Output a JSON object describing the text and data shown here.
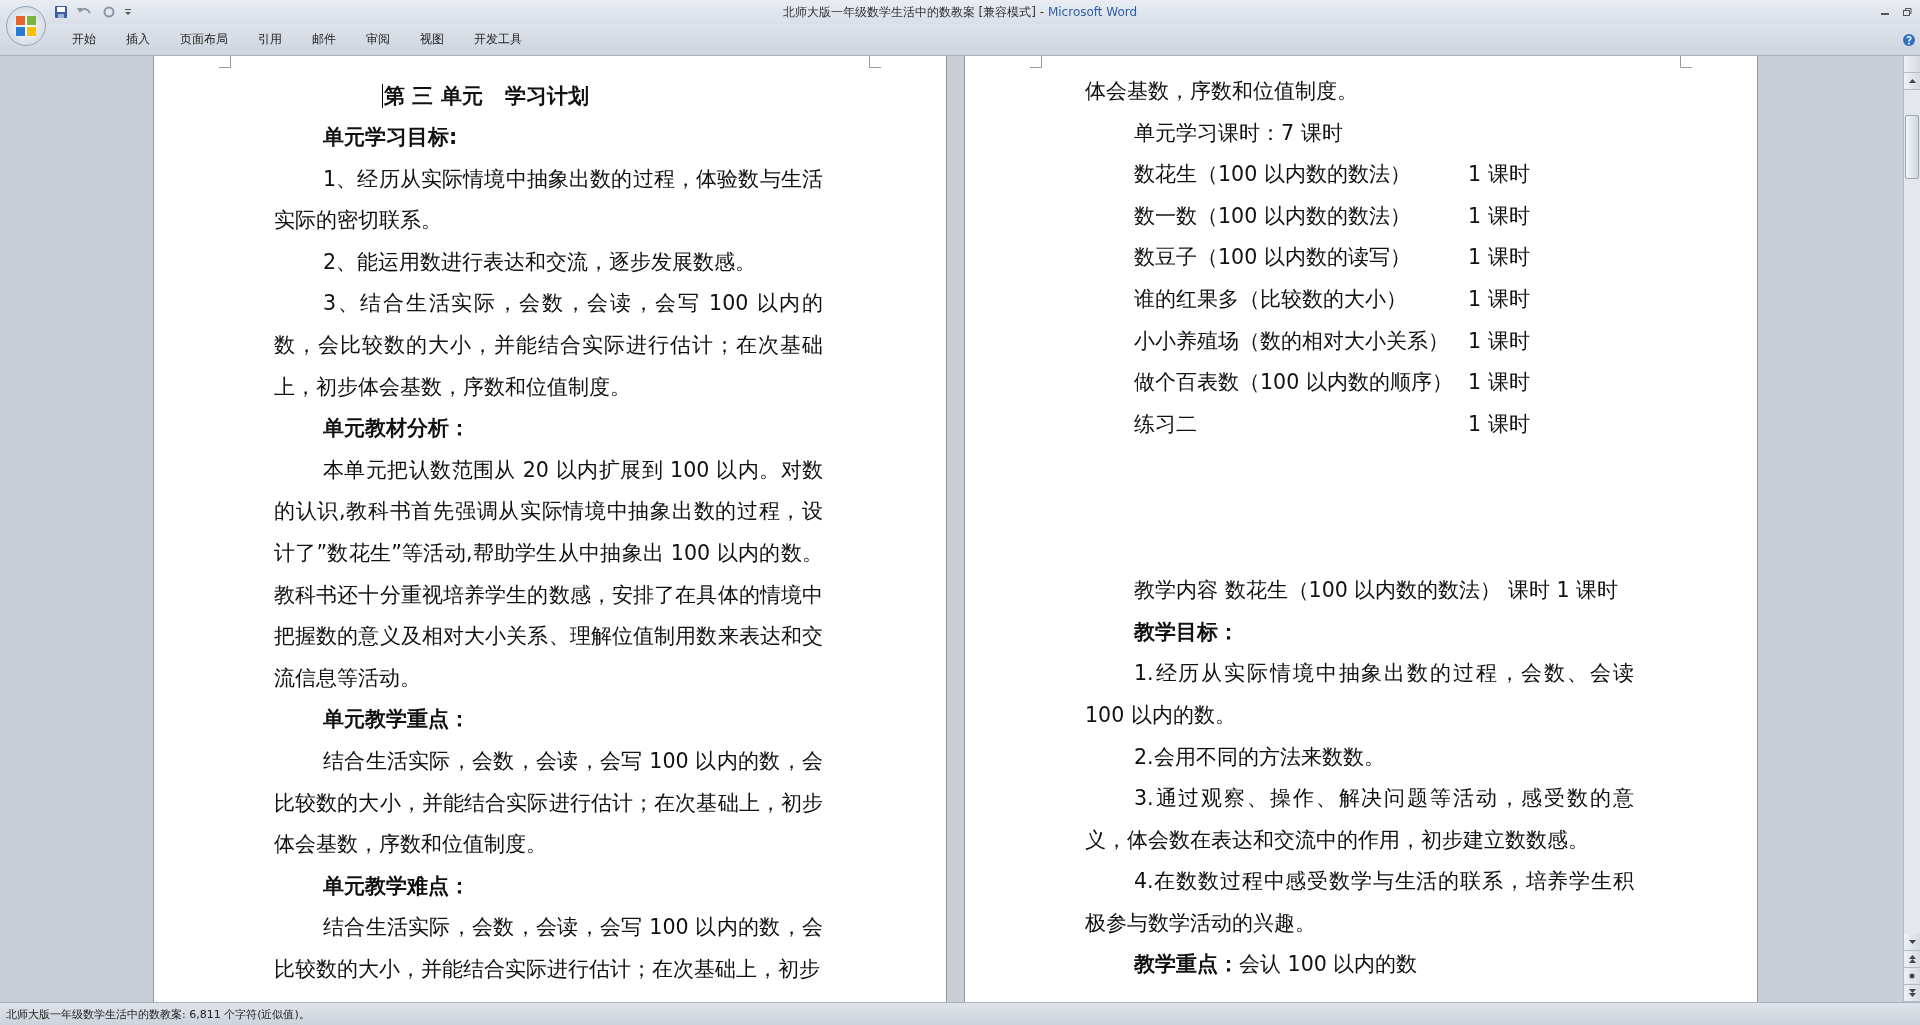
{
  "window": {
    "document": "北师大版一年级数学生活中的数教案 [兼容模式]",
    "separator": "-",
    "app": "Microsoft Word"
  },
  "ribbon_tabs": [
    {
      "label": "开始",
      "selected": false
    },
    {
      "label": "插入",
      "selected": false
    },
    {
      "label": "页面布局",
      "selected": false
    },
    {
      "label": "引用",
      "selected": false
    },
    {
      "label": "邮件",
      "selected": false
    },
    {
      "label": "审阅",
      "selected": false
    },
    {
      "label": "视图",
      "selected": false
    },
    {
      "label": "开发工具",
      "selected": false
    }
  ],
  "pages": [
    {
      "blocks": [
        {
          "kind": "title",
          "text": "第 三 单元   学习计划"
        },
        {
          "kind": "heading",
          "text": "单元学习目标:"
        },
        {
          "kind": "para",
          "text": "1、经历从实际情境中抽象出数的过程，体验数与生活实际的密切联系。"
        },
        {
          "kind": "para",
          "text": "2、能运用数进行表达和交流，逐步发展数感。"
        },
        {
          "kind": "para",
          "text": "3、结合生活实际，会数，会读，会写 100 以内的数，会比较数的大小，并能结合实际进行估计；在次基础上，初步体会基数，序数和位值制度。"
        },
        {
          "kind": "heading",
          "text": "单元教材分析："
        },
        {
          "kind": "para",
          "text": "本单元把认数范围从 20 以内扩展到 100 以内。对数的认识,教科书首先强调从实际情境中抽象出数的过程，设计了”数花生”等活动,帮助学生从中抽象出 100 以内的数。教科书还十分重视培养学生的数感，安排了在具体的情境中把握数的意义及相对大小关系、理解位值制用数来表达和交流信息等活动。"
        },
        {
          "kind": "heading",
          "text": "单元教学重点："
        },
        {
          "kind": "para",
          "text": "结合生活实际，会数，会读，会写 100 以内的数，会比较数的大小，并能结合实际进行估计；在次基础上，初步体会基数，序数和位值制度。"
        },
        {
          "kind": "heading",
          "text": "单元教学难点："
        },
        {
          "kind": "para",
          "text": "结合生活实际，会数，会读，会写 100 以内的数，会比较数的大小，并能结合实际进行估计；在次基础上，初步"
        }
      ]
    },
    {
      "blocks": [
        {
          "kind": "continued",
          "text": "体会基数，序数和位值制度。"
        },
        {
          "kind": "para",
          "text": "单元学习课时：7 课时"
        },
        {
          "kind": "lesson",
          "text": "数花生（100 以内数的数法）",
          "hours": "1 课时"
        },
        {
          "kind": "lesson",
          "text": "数一数（100 以内数的数法）",
          "hours": "1 课时"
        },
        {
          "kind": "lesson",
          "text": "数豆子（100 以内数的读写）",
          "hours": "1 课时"
        },
        {
          "kind": "lesson",
          "text": "谁的红果多（比较数的大小）",
          "hours": "1 课时"
        },
        {
          "kind": "lesson",
          "text": "小小养殖场（数的相对大小关系）",
          "hours": "1 课时"
        },
        {
          "kind": "lesson",
          "text": "做个百表数（100 以内数的顺序）",
          "hours": "1 课时"
        },
        {
          "kind": "lesson",
          "text": "练习二",
          "hours": "1 课时"
        },
        {
          "kind": "blank"
        },
        {
          "kind": "blank"
        },
        {
          "kind": "blank"
        },
        {
          "kind": "para",
          "text": "教学内容 数花生（100 以内数的数法）  课时  1 课时"
        },
        {
          "kind": "heading",
          "text": "教学目标："
        },
        {
          "kind": "para",
          "text": "1.经历从实际情境中抽象出数的过程，会数、会读 100 以内的数。"
        },
        {
          "kind": "para",
          "text": "2.会用不同的方法来数数。"
        },
        {
          "kind": "para",
          "text": "3.通过观察、操作、解决问题等活动，感受数的意义，体会数在表达和交流中的作用，初步建立数数感。"
        },
        {
          "kind": "para",
          "text": "4.在数数过程中感受数学与生活的联系，培养学生积极参与数学活动的兴趣。"
        },
        {
          "kind": "para",
          "text": "**教学重点：**会认 100 以内的数"
        }
      ]
    }
  ],
  "status_bar": {
    "text": "北师大版一年级数学生活中的数教案: 6,811 个字符(近似值)。"
  }
}
